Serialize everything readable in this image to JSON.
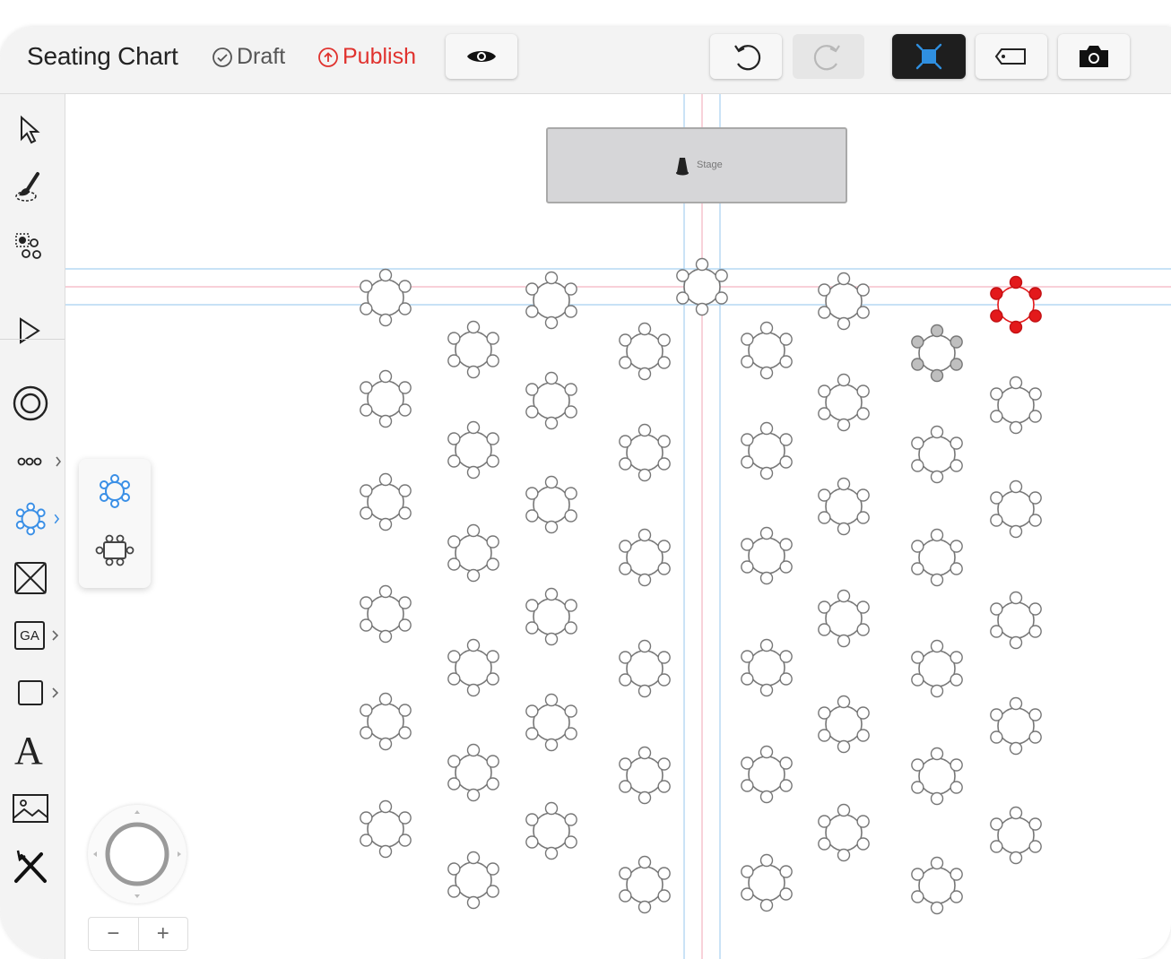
{
  "header": {
    "title": "Seating Chart",
    "draft_label": "Draft",
    "publish_label": "Publish"
  },
  "toolbar": {
    "icons": [
      "eye-icon",
      "undo-icon",
      "redo-icon",
      "selection-mode-icon",
      "tag-icon",
      "camera-icon"
    ]
  },
  "sidebar": {
    "tools": [
      "select",
      "brush",
      "seat-select",
      "node-select",
      "round-seat",
      "row",
      "round-table",
      "booth",
      "general-admission",
      "shape",
      "text",
      "image",
      "food"
    ],
    "ga_label": "GA",
    "text_label": "A"
  },
  "flyout": {
    "options": [
      "round-table",
      "rectangle-table"
    ]
  },
  "stage": {
    "label": "Stage"
  },
  "zoom": {
    "minus": "−",
    "plus": "+"
  },
  "colors": {
    "accent": "#4a90e2",
    "publish": "#e0322e",
    "selected_table": "#e3191b",
    "hover_table": "#bfbfbf",
    "guide_blue": "#a8d0f0",
    "guide_pink": "#f3b5c0"
  }
}
